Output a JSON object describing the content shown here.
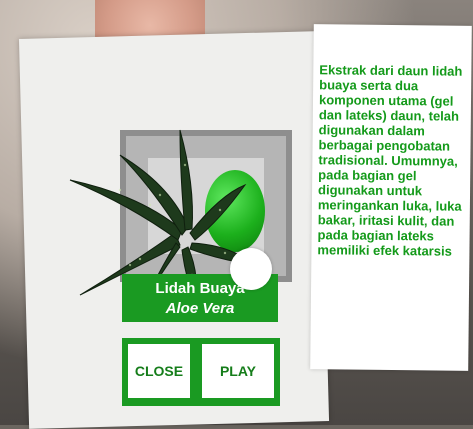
{
  "ar_card": {
    "plant_name": "Lidah Buaya",
    "plant_latin": "Aloe Vera"
  },
  "buttons": {
    "close_label": "CLOSE",
    "play_label": "PLAY"
  },
  "description": {
    "text": "Ekstrak dari daun lidah buaya serta dua komponen utama (gel dan lateks) daun, telah digunakan dalam berbagai pengobatan tradisional. Umumnya, pada bagian gel digunakan untuk meringankan luka, luka bakar, iritasi kulit, dan pada bagian lateks memiliki efek katarsis"
  },
  "colors": {
    "accent_green": "#1a9a22",
    "text_green": "#149a1a",
    "panel_white": "#ffffff"
  },
  "icons": {
    "plant_model": "aloe-vera-3d-model",
    "indicator": "white-circle"
  }
}
